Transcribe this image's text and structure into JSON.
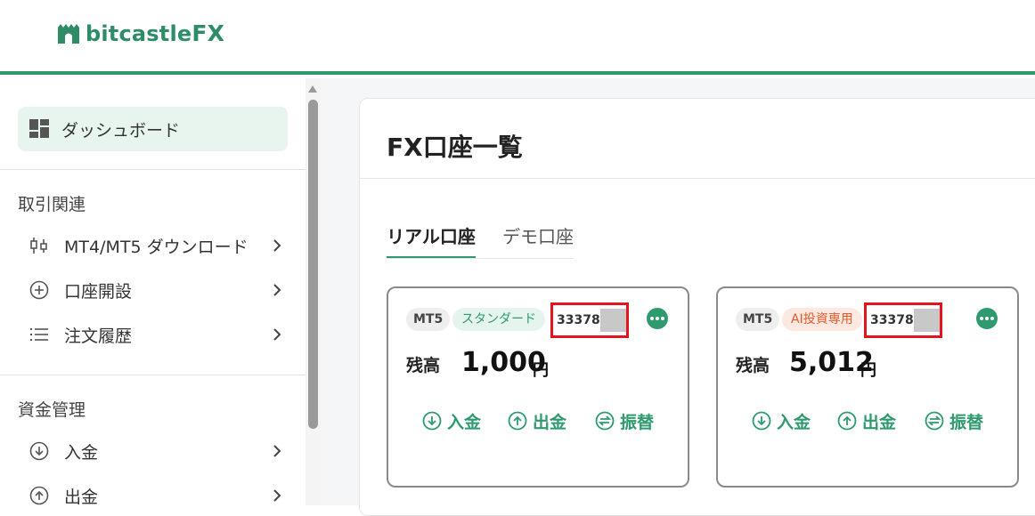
{
  "header": {
    "logo_text": "bitcastle",
    "logo_fx": "FX"
  },
  "sidebar": {
    "dashboard": "ダッシュボード",
    "sections": [
      {
        "title": "取引関連",
        "items": [
          {
            "label": "MT4/MT5 ダウンロード",
            "icon": "candlestick-icon"
          },
          {
            "label": "口座開設",
            "icon": "plus-circle-icon"
          },
          {
            "label": "注文履歴",
            "icon": "list-icon"
          }
        ]
      },
      {
        "title": "資金管理",
        "items": [
          {
            "label": "入金",
            "icon": "deposit-icon"
          },
          {
            "label": "出金",
            "icon": "withdraw-icon"
          }
        ]
      }
    ]
  },
  "main": {
    "title": "FX口座一覧",
    "tabs": [
      "リアル口座",
      "デモ口座"
    ],
    "active_tab": "リアル口座",
    "accounts": [
      {
        "platform": "MT5",
        "type": "スタンダード",
        "account_number": "33378",
        "balance_label": "残高",
        "balance": "1,000",
        "currency": "円"
      },
      {
        "platform": "MT5",
        "type": "AI投資専用",
        "account_number": "33378",
        "balance_label": "残高",
        "balance": "5,012",
        "currency": "円"
      }
    ],
    "actions": {
      "deposit": "入金",
      "withdraw": "出金",
      "transfer": "振替"
    }
  },
  "colors": {
    "brand": "#2e9a6e",
    "highlight": "#e0161c",
    "ai_badge": "#e85a2a"
  }
}
